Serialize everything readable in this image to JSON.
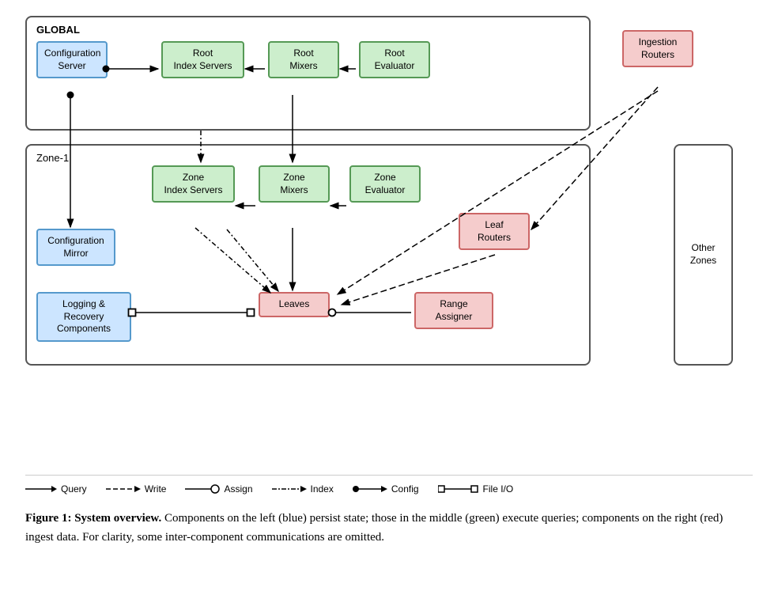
{
  "diagram": {
    "global_label": "GLOBAL",
    "zone1_label": "Zone-1",
    "other_zones_label": "Other\nZones",
    "components": {
      "config_server": "Configuration\nServer",
      "root_index_servers": "Root\nIndex Servers",
      "root_mixers": "Root\nMixers",
      "root_evaluator": "Root\nEvaluator",
      "ingestion_routers": "Ingestion\nRouters",
      "zone_index_servers": "Zone\nIndex Servers",
      "zone_mixers": "Zone\nMixers",
      "zone_evaluator": "Zone\nEvaluator",
      "config_mirror": "Configuration\nMirror",
      "leaf_routers": "Leaf\nRouters",
      "logging_recovery": "Logging & Recovery\nComponents",
      "leaves": "Leaves",
      "range_assigner": "Range\nAssigner"
    }
  },
  "legend": {
    "query_label": "Query",
    "write_label": "Write",
    "assign_label": "Assign",
    "index_label": "Index",
    "config_label": "Config",
    "fileio_label": "File I/O"
  },
  "caption": {
    "figure_label": "Figure 1:",
    "title": "System overview.",
    "body": " Components on the left (blue) persist state; those in the middle (green) execute queries; components on the right (red) ingest data.  For clarity, some inter-component communications are omitted."
  }
}
